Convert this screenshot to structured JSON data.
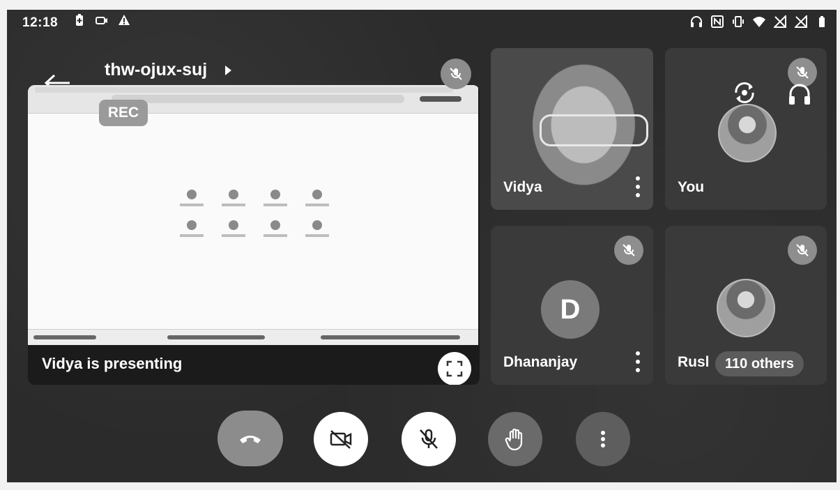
{
  "status_bar": {
    "time": "12:18",
    "left_icons": [
      "battery-saver-icon",
      "camera-icon",
      "warning-icon"
    ],
    "right_icons": [
      "headphones-icon",
      "nfc-icon",
      "vibrate-icon",
      "wifi-icon",
      "no-signal-icon",
      "no-signal-icon",
      "battery-icon"
    ]
  },
  "meeting": {
    "code": "thw-ojux-suj",
    "rec_label": "REC",
    "presenting_label": "Vidya is presenting"
  },
  "participants": [
    {
      "name": "Vidya",
      "avatar_type": "video"
    },
    {
      "name": "You",
      "avatar_type": "photo"
    },
    {
      "name": "Dhananjay",
      "avatar_type": "letter",
      "initial": "D"
    },
    {
      "name": "Rusl",
      "avatar_type": "photo",
      "others_label": "110 others"
    }
  ],
  "controls": {
    "end_call": "end-call-icon",
    "camera": "camera-off-icon",
    "microphone": "mic-off-icon",
    "raise_hand": "raise-hand-icon",
    "more": "more-vert-icon"
  },
  "colors": {
    "screen_background": "#2b2b2b",
    "tile_background": "#3a3a3a",
    "control_light": "#ffffff",
    "control_dark": "#5e5e5e"
  }
}
